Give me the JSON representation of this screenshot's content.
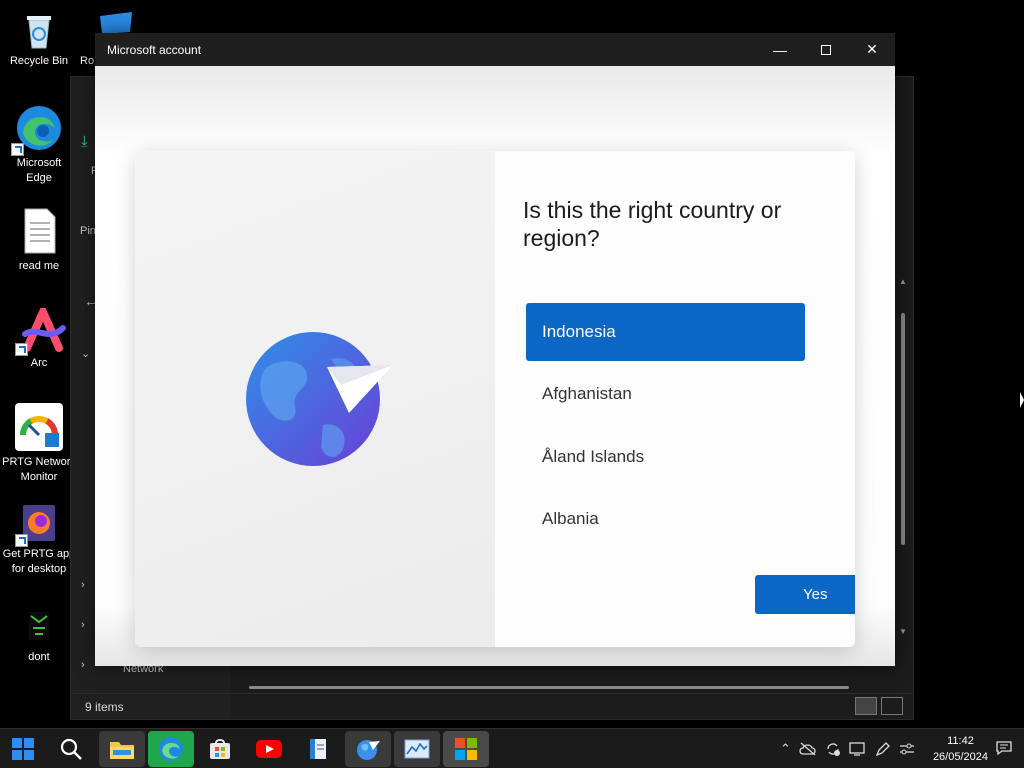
{
  "desktop": {
    "icons": [
      {
        "label": "Recycle Bin"
      },
      {
        "label": "Ro"
      },
      {
        "label": "Microsoft\nEdge"
      },
      {
        "label": "read me"
      },
      {
        "label": "Arc"
      },
      {
        "label": "PRTG Network\nMonitor"
      },
      {
        "label": "Get PRTG app\nfor desktop"
      },
      {
        "label": "dont"
      }
    ]
  },
  "explorer": {
    "fragments": {
      "f": "F",
      "pin": "Pin",
      "network": "Network"
    },
    "status": "9 items"
  },
  "dialog": {
    "title": "Microsoft account",
    "heading": "Is this the right country or region?",
    "options": [
      "Indonesia",
      "Afghanistan",
      "Åland Islands",
      "Albania"
    ],
    "selected_index": 0,
    "yes_label": "Yes"
  },
  "taskbar": {
    "apps": [
      "start-icon",
      "search-icon",
      "file-explorer-icon",
      "edge-icon",
      "store-icon",
      "youtube-icon",
      "notepad-icon",
      "globe-app-icon",
      "monitor-app-icon",
      "microsoft-icon"
    ],
    "time": "11:42",
    "date": "26/05/2024"
  },
  "colors": {
    "accent": "#0a67c4",
    "titlebar": "#1f1f1f"
  }
}
